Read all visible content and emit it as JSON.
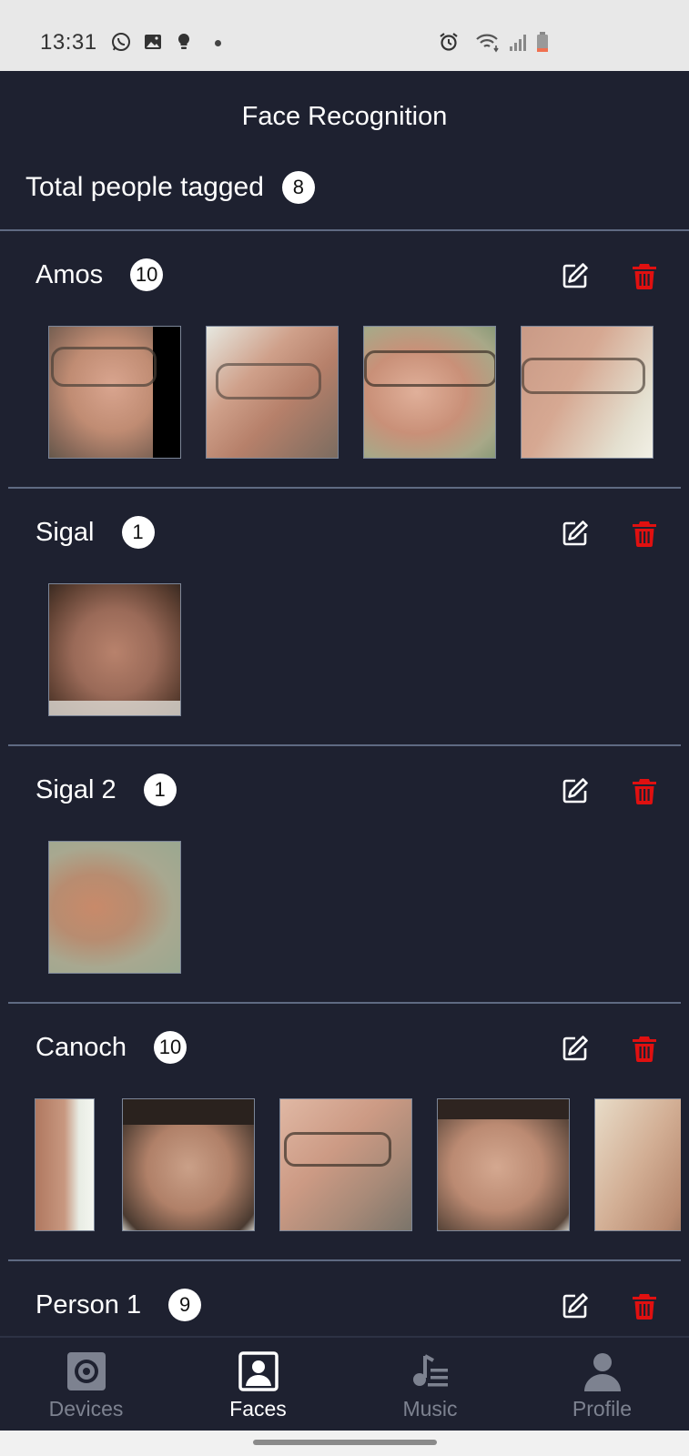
{
  "status_bar": {
    "time": "13:31",
    "left_icons": [
      "whatsapp-icon",
      "gallery-icon",
      "bulb-icon",
      "dot"
    ],
    "right_icons": [
      "alarm-icon",
      "wifi-icon",
      "signal-icon",
      "battery-icon"
    ]
  },
  "header": {
    "title": "Face Recognition",
    "total_label": "Total people tagged",
    "total_count": "8"
  },
  "colors": {
    "background": "#1e2130",
    "divider": "#5f6a82",
    "delete_red": "#e01010",
    "nav_inactive": "#7d8290"
  },
  "people": [
    {
      "name": "Amos",
      "count": "10"
    },
    {
      "name": "Sigal",
      "count": "1"
    },
    {
      "name": "Sigal 2",
      "count": "1"
    },
    {
      "name": "Canoch",
      "count": "10"
    },
    {
      "name": "Person 1",
      "count": "9"
    }
  ],
  "actions": {
    "edit_icon": "edit-icon",
    "delete_icon": "trash-icon"
  },
  "nav": [
    {
      "label": "Devices",
      "icon": "speaker-icon",
      "active": false
    },
    {
      "label": "Faces",
      "icon": "portrait-icon",
      "active": true
    },
    {
      "label": "Music",
      "icon": "music-list-icon",
      "active": false
    },
    {
      "label": "Profile",
      "icon": "person-icon",
      "active": false
    }
  ]
}
